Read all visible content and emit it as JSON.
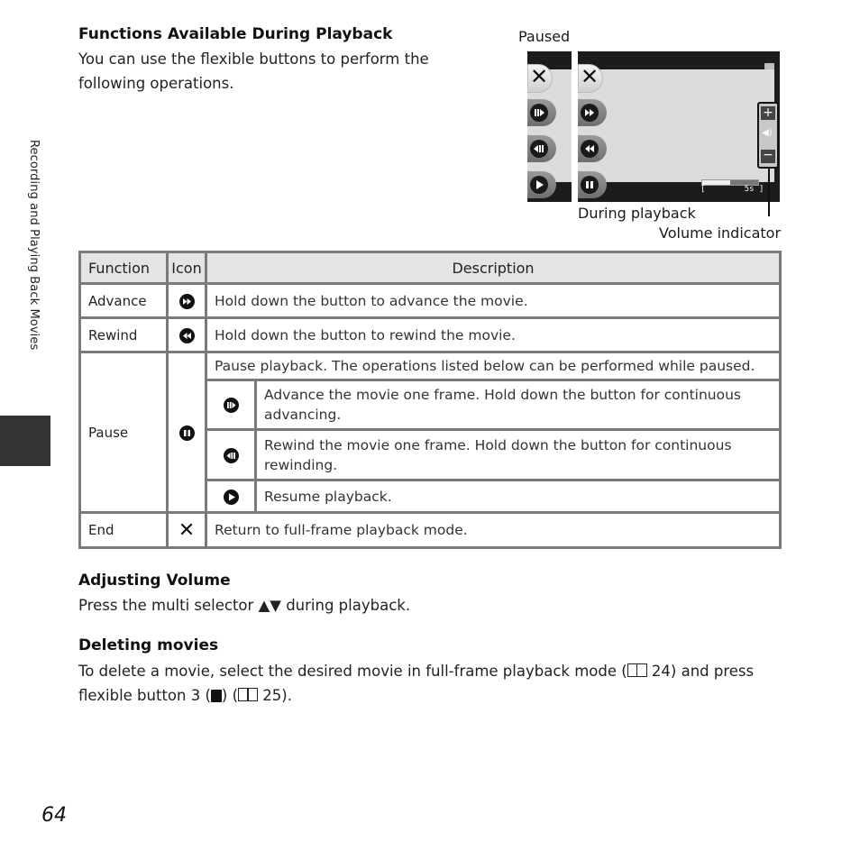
{
  "side_tab": {
    "label": "Recording and Playing Back Movies"
  },
  "section1": {
    "heading": "Functions Available During Playback",
    "intro_line1": "You can use the flexible buttons to perform the",
    "intro_line2": "following operations."
  },
  "illustration": {
    "paused_label": "Paused",
    "playback_label": "During playback",
    "volume_label": "Volume indicator",
    "time_readout": "[        5s ]",
    "progress_fraction": 0.5
  },
  "table": {
    "headers": {
      "function": "Function",
      "icon": "Icon",
      "description": "Description"
    },
    "advance": {
      "function": "Advance",
      "icon": "fast-forward-icon",
      "description": "Hold down the button to advance the movie."
    },
    "rewind": {
      "function": "Rewind",
      "icon": "rewind-icon",
      "description": "Hold down the button to rewind the movie."
    },
    "pause": {
      "function": "Pause",
      "icon": "pause-icon",
      "description": "Pause playback. The operations listed below can be performed while paused.",
      "sub": [
        {
          "icon": "frame-advance-icon",
          "description": "Advance the movie one frame. Hold down the button for continuous advancing."
        },
        {
          "icon": "frame-rewind-icon",
          "description": "Rewind the movie one frame. Hold down the button for continuous rewinding."
        },
        {
          "icon": "play-icon",
          "description": "Resume playback."
        }
      ]
    },
    "end": {
      "function": "End",
      "icon": "close-icon",
      "description": "Return to full-frame playback mode."
    }
  },
  "volume": {
    "heading": "Adjusting Volume",
    "text_before": "Press the multi selector ",
    "arrows": "▲▼",
    "text_after": " during playback."
  },
  "delete": {
    "heading": "Deleting movies",
    "line1_a": "To delete a movie, select the desired movie in full-frame playback mode (",
    "line1_ref": "24",
    "line1_b": ") and press",
    "line2_a": "flexible button 3 (",
    "line2_b": ") (",
    "line2_ref": "25",
    "line2_c": ")."
  },
  "page_number": "64"
}
